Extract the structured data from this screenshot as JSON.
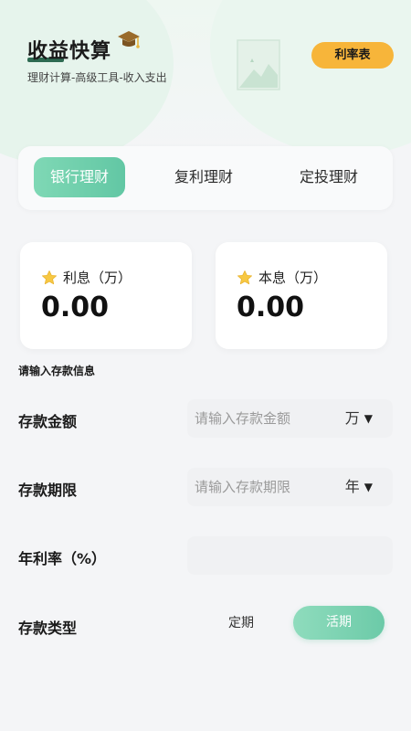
{
  "header": {
    "title": "收益快算",
    "subtitle": "理财计算-高级工具-收入支出",
    "rate_button": "利率表"
  },
  "tabs": [
    {
      "label": "银行理财",
      "active": true
    },
    {
      "label": "复利理财",
      "active": false
    },
    {
      "label": "定投理财",
      "active": false
    }
  ],
  "results": {
    "interest": {
      "label": "利息（万）",
      "value": "0.00"
    },
    "total": {
      "label": "本息（万）",
      "value": "0.00"
    }
  },
  "form": {
    "section_title": "请输入存款信息",
    "amount": {
      "label": "存款金额",
      "placeholder": "请输入存款金额",
      "value": "",
      "unit": "万"
    },
    "term": {
      "label": "存款期限",
      "placeholder": "请输入存款期限",
      "value": "",
      "unit": "年"
    },
    "rate": {
      "label": "年利率（%）",
      "placeholder": "",
      "value": ""
    },
    "type": {
      "label": "存款类型",
      "options": [
        "定期",
        "活期"
      ],
      "selected": "活期"
    }
  },
  "colors": {
    "accent_green": "#6ccaa8",
    "rate_button": "#f7b53a",
    "background": "#f4f5f7"
  },
  "icons": [
    "graduation-cap-icon",
    "star-icon",
    "caret-down-icon"
  ]
}
